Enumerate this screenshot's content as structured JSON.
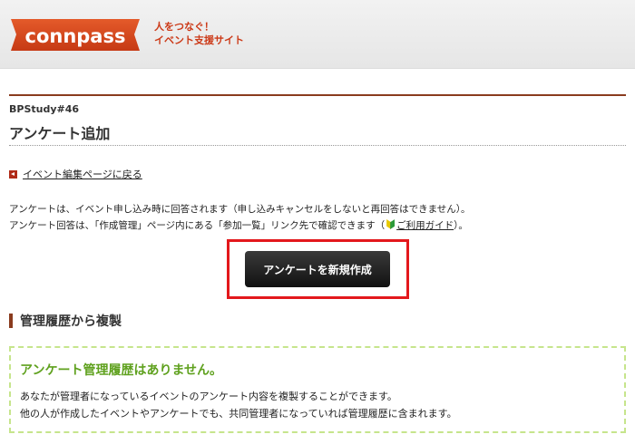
{
  "header": {
    "logo_text": "connpass",
    "tagline_line1": "人をつなぐ！",
    "tagline_line2": "イベント支援サイト",
    "brand_color": "#d64a1f"
  },
  "page": {
    "event_name": "BPStudy#46",
    "title": "アンケート追加",
    "back_link": "イベント編集ページに戻る",
    "description_line1": "アンケートは、イベント申し込み時に回答されます（申し込みキャンセルをしないと再回答はできません）。",
    "description_line2_prefix": "アンケート回答は、「作成管理」ページ内にある「参加一覧」リンク先で確認できます（",
    "guide_link": "ご利用ガイド",
    "description_line2_suffix": "）。",
    "create_button": "アンケートを新規作成",
    "highlight_color": "#e3181c"
  },
  "history": {
    "section_title": "管理履歴から複製",
    "empty_title": "アンケート管理履歴はありません。",
    "empty_text_line1": "あなたが管理者になっているイベントのアンケート内容を複製することができます。",
    "empty_text_line2": "他の人が作成したイベントやアンケートでも、共同管理者になっていれば管理履歴に含まれます。",
    "accent_color": "#5fa11e"
  },
  "icons": {
    "back": "back-arrow-icon",
    "guide": "beginner-mark-icon"
  }
}
